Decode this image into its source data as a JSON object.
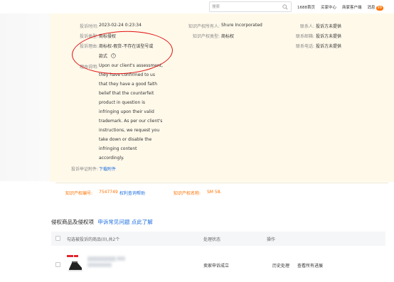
{
  "header": {
    "search_placeholder": "搜索",
    "links": [
      "1688首页",
      "买家中心",
      "商家客户端",
      "消息"
    ],
    "message_count": "99"
  },
  "complaint": {
    "time_label": "投诉时间:",
    "time_value": "2023-02-24 0:23:34",
    "type_label": "投诉类型:",
    "type_value": "商标侵权",
    "reason_label": "投诉理由:",
    "reason_value_line1": "商标权-假货-不存在该型号或",
    "reason_value_line2": "款式",
    "desc_label": "理由说明:",
    "desc_lines": [
      "Upon our client's assessment,",
      "they have confirmed to us",
      "that they have a good faith",
      "belief that the counterfeit",
      "product in question is",
      "infringing upon their valid",
      "trademark. As per our client's",
      "instructions, we request you",
      "take down or disable the",
      "infringing content",
      "accordingly."
    ],
    "attachment_label": "投诉举证附件:",
    "attachment_link": "下载附件",
    "owner_label": "知识产权所有人:",
    "owner_value": "Shure Incorporated",
    "ip_type_label": "知识产权类型:",
    "ip_type_value": "商标权",
    "contact_label": "联系人:",
    "contact_value": "投诉方未提供",
    "email_label": "联系邮箱:",
    "email_value": "投诉方未提供",
    "phone_label": "联系电话:",
    "phone_value": "投诉方未提供",
    "ip_number_label": "知识产权编号:",
    "ip_number_value": "7547749",
    "ip_query_link": "权利查询帮助",
    "ip_name_label": "知识产权名称:",
    "ip_name_value": "SM 58."
  },
  "goods": {
    "title": "侵权商品及侵权项",
    "faq_link": "申诉常见问题 点此了解",
    "select_label": "勾选被投诉的商品(0),共2个",
    "col_status": "处理状态",
    "col_action": "操作",
    "rows": [
      {
        "status": "卖家申诉成立",
        "action_history": "历史处理",
        "action_progress": "查看所有进展"
      }
    ]
  }
}
